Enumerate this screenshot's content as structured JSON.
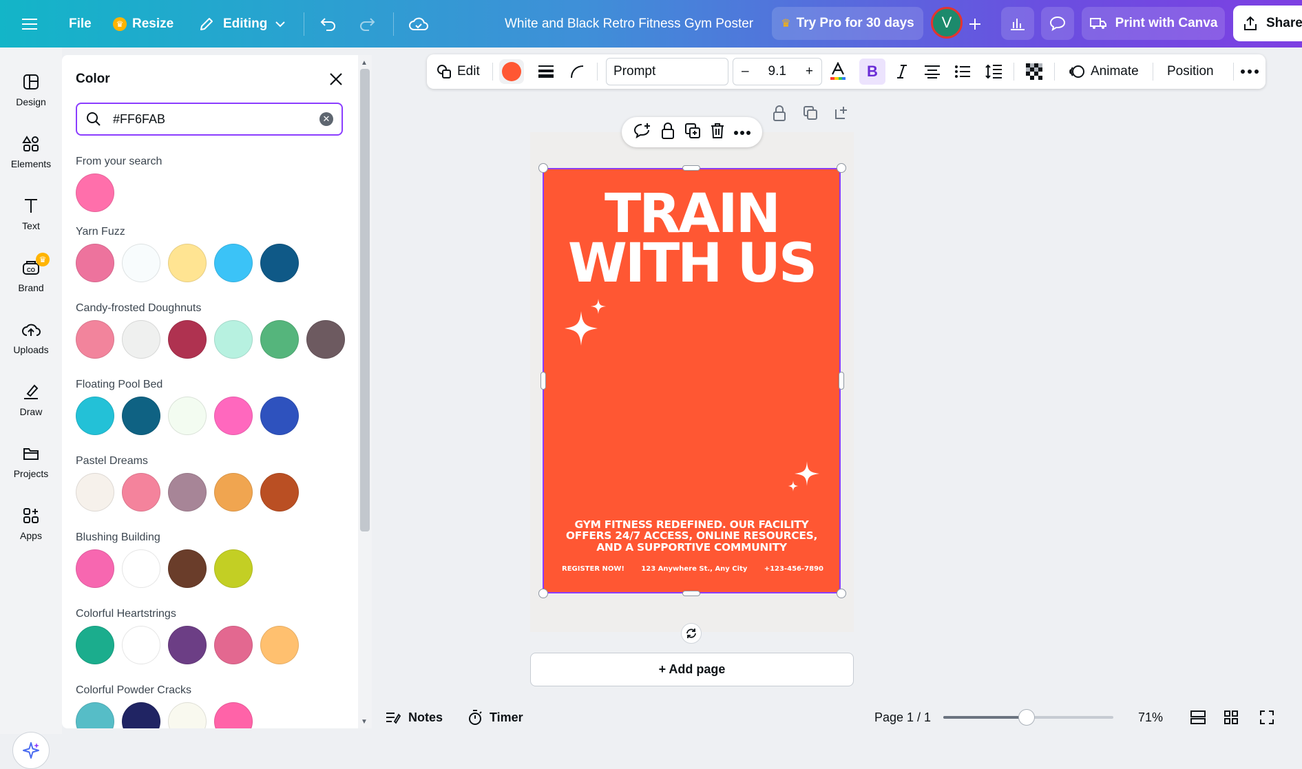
{
  "topbar": {
    "file_label": "File",
    "resize_label": "Resize",
    "editing_label": "Editing",
    "doc_title": "White and Black Retro Fitness Gym Poster",
    "pro_label": "Try Pro for 30 days",
    "avatar_initial": "V",
    "print_label": "Print with Canva",
    "share_label": "Share"
  },
  "sidebar": {
    "items": [
      {
        "label": "Design",
        "icon": "design-icon"
      },
      {
        "label": "Elements",
        "icon": "elements-icon"
      },
      {
        "label": "Text",
        "icon": "text-icon"
      },
      {
        "label": "Brand",
        "icon": "brand-icon"
      },
      {
        "label": "Uploads",
        "icon": "uploads-icon"
      },
      {
        "label": "Draw",
        "icon": "draw-icon"
      },
      {
        "label": "Projects",
        "icon": "projects-icon"
      },
      {
        "label": "Apps",
        "icon": "apps-icon"
      }
    ],
    "brand_badge": "♛"
  },
  "color_panel": {
    "title": "Color",
    "search_value": "#FF6FAB",
    "groups": [
      {
        "name": "From your search",
        "colors": [
          "#FF6FAB"
        ]
      },
      {
        "name": "Yarn Fuzz",
        "colors": [
          "#ED739D",
          "#F8FCFD",
          "#FFE492",
          "#3BC3F7",
          "#0F5987"
        ]
      },
      {
        "name": "Candy-frosted Doughnuts",
        "colors": [
          "#F2849C",
          "#EFF0EF",
          "#AF3250",
          "#B7F1E0",
          "#55B57C",
          "#6D5A60"
        ]
      },
      {
        "name": "Floating Pool Bed",
        "colors": [
          "#23C1D7",
          "#0F6283",
          "#F3FCF1",
          "#FF68BE",
          "#2E52BE"
        ]
      },
      {
        "name": "Pastel Dreams",
        "colors": [
          "#F6F1EB",
          "#F4839C",
          "#A78597",
          "#F0A550",
          "#BA4F23"
        ]
      },
      {
        "name": "Blushing Building",
        "colors": [
          "#F767B0",
          "#FFFFFF",
          "#6A3D2A",
          "#C3CF24"
        ]
      },
      {
        "name": "Colorful Heartstrings",
        "colors": [
          "#1BAD8D",
          "#FFFFFF",
          "#6C3E85",
          "#E36890",
          "#FFC06F"
        ]
      },
      {
        "name": "Colorful Powder Cracks",
        "colors": [
          "#56BDC7",
          "#202463",
          "#F9F9EF",
          "#FF63A8"
        ]
      }
    ]
  },
  "toolbar": {
    "edit_label": "Edit",
    "fill_color": "#FF5733",
    "font_name": "Prompt",
    "font_size": "9.1",
    "minus": "–",
    "plus": "+",
    "bold": "B",
    "animate_label": "Animate",
    "position_label": "Position"
  },
  "poster": {
    "background": "#FF5733",
    "title_line1": "TRAIN",
    "title_line2": "WITH US",
    "body": "GYM FITNESS REDEFINED. OUR FACILITY OFFERS 24/7 ACCESS, ONLINE RESOURCES, AND A SUPPORTIVE COMMUNITY",
    "footer": [
      "REGISTER NOW!",
      "123 Anywhere St., Any City",
      "+123-456-7890"
    ]
  },
  "canvas": {
    "add_page_label": "+ Add page"
  },
  "bottombar": {
    "notes_label": "Notes",
    "timer_label": "Timer",
    "page_indicator": "Page 1 / 1",
    "zoom": "71%",
    "zoom_value": 71
  }
}
